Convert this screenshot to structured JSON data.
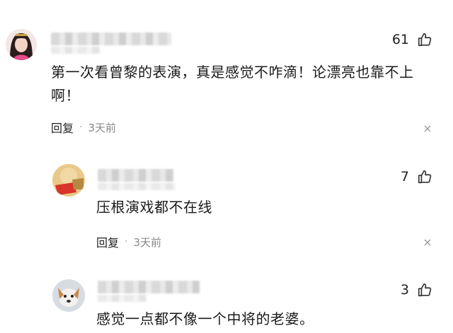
{
  "comments": [
    {
      "likes": "61",
      "text_line1": "第一次看曾黎的表演，真是感觉不咋滴！论漂亮也靠不上",
      "text_line2": "啊！",
      "reply_label": "回复",
      "time": "3天前"
    },
    {
      "likes": "7",
      "text": "压根演戏都不在线",
      "reply_label": "回复",
      "time": "3天前"
    },
    {
      "likes": "3",
      "text": "感觉一点都不像一个中将的老婆。"
    }
  ],
  "meta_separator": "·",
  "icons": {
    "like": "thumbs-up-icon",
    "dismiss": "close-icon"
  },
  "colors": {
    "text": "#1a1a1a",
    "muted": "#888888",
    "icon": "#333333"
  }
}
